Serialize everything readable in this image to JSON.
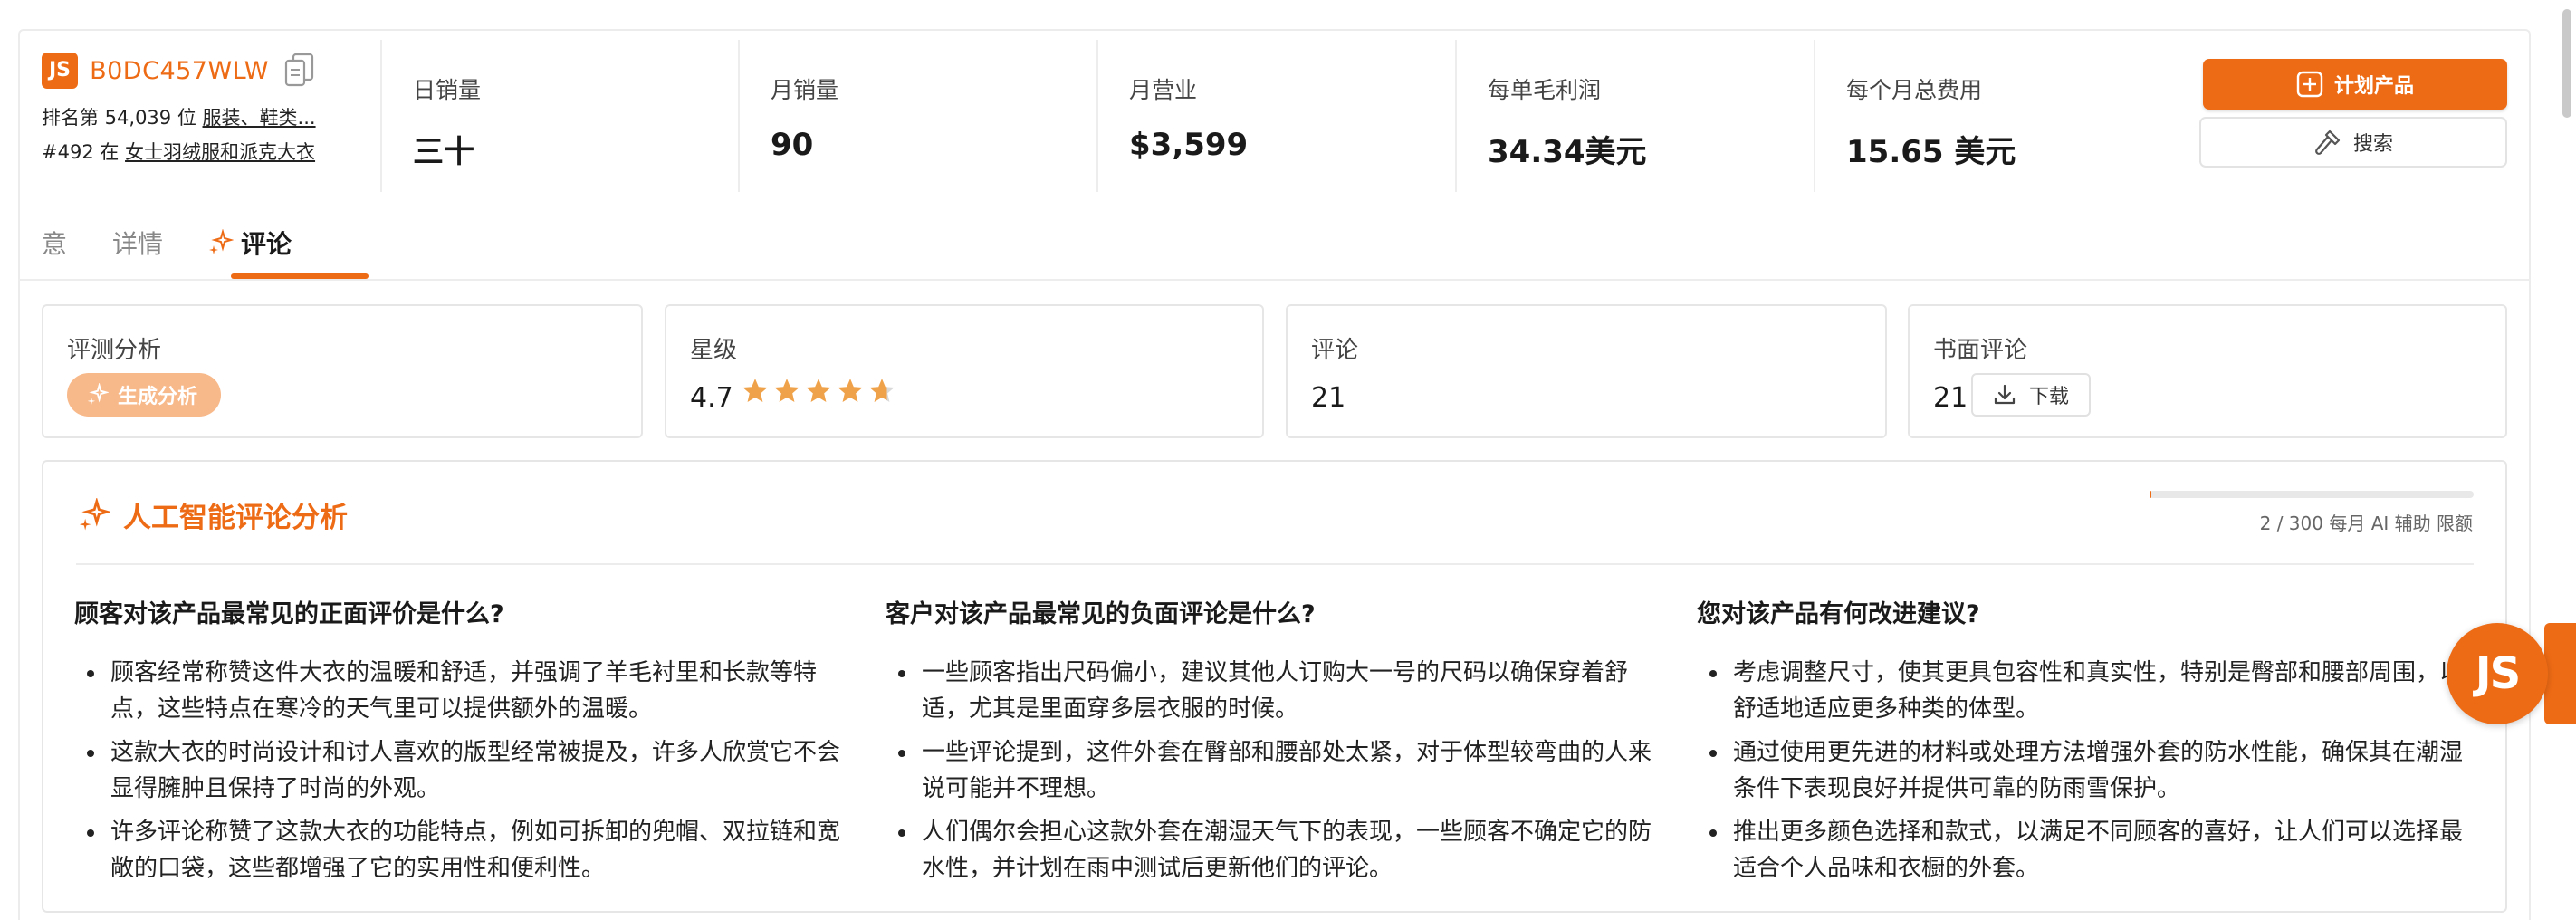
{
  "product": {
    "logo_text": "JS",
    "asin": "B0DC457WLW",
    "rank1_prefix": "排名第 54,039 位",
    "rank1_link": "服装、鞋类...",
    "rank2_prefix": "#492 在",
    "rank2_link": "女士羽绒服和派克大衣"
  },
  "metrics": [
    {
      "label": "日销量",
      "value": "三十"
    },
    {
      "label": "月销量",
      "value": "90"
    },
    {
      "label": "月营业",
      "value": "$3,599"
    },
    {
      "label": "每单毛利润",
      "value": "34.34美元"
    },
    {
      "label": "每个月总费用",
      "value": "15.65 美元"
    }
  ],
  "actions": {
    "plan_label": "计划产品",
    "search_label": "搜索"
  },
  "tabs": [
    {
      "label": "意"
    },
    {
      "label": "详情"
    },
    {
      "label": "评论"
    }
  ],
  "cards": {
    "analysis": {
      "label": "评测分析",
      "button": "生成分析"
    },
    "rating": {
      "label": "星级",
      "value": "4.7",
      "stars": 4.7
    },
    "reviews": {
      "label": "评论",
      "value": "21"
    },
    "written": {
      "label": "书面评论",
      "value": "21",
      "download": "下载"
    }
  },
  "ai": {
    "title": "人工智能评论分析",
    "quota_text": "2 / 300 每月 AI 辅助 限额",
    "quota_used": 2,
    "quota_total": 300,
    "columns": [
      {
        "question": "顾客对该产品最常见的正面评价是什么?",
        "points": [
          "顾客经常称赞这件大衣的温暖和舒适，并强调了羊毛衬里和长款等特点，这些特点在寒冷的天气里可以提供额外的温暖。",
          "这款大衣的时尚设计和讨人喜欢的版型经常被提及，许多人欣赏它不会显得臃肿且保持了时尚的外观。",
          "许多评论称赞了这款大衣的功能特点，例如可拆卸的兜帽、双拉链和宽敞的口袋，这些都增强了它的实用性和便利性。"
        ]
      },
      {
        "question": "客户对该产品最常见的负面评论是什么?",
        "points": [
          "一些顾客指出尺码偏小，建议其他人订购大一号的尺码以确保穿着舒适，尤其是里面穿多层衣服的时候。",
          "一些评论提到，这件外套在臀部和腰部处太紧，对于体型较弯曲的人来说可能并不理想。",
          "人们偶尔会担心这款外套在潮湿天气下的表现，一些顾客不确定它的防水性，并计划在雨中测试后更新他们的评论。"
        ]
      },
      {
        "question": "您对该产品有何改进建议?",
        "points": [
          "考虑调整尺寸，使其更具包容性和真实性，特别是臀部和腰部周围，以舒适地适应更多种类的体型。",
          "通过使用更先进的材料或处理方法增强外套的防水性能，确保其在潮湿条件下表现良好并提供可靠的防雨雪保护。",
          "推出更多颜色选择和款式，以满足不同顾客的喜好，让人们可以选择最适合个人品味和衣橱的外套。"
        ]
      }
    ]
  },
  "floating": {
    "badge_text": "JS"
  },
  "colors": {
    "accent": "#ee6b15",
    "accent_light": "#f8b98a",
    "star": "#f0a24a",
    "star_empty": "#d9d9d9"
  },
  "icons": [
    "copy-icon",
    "plus-square-icon",
    "hammer-icon",
    "sparkle-icon",
    "star-icon",
    "download-icon"
  ]
}
